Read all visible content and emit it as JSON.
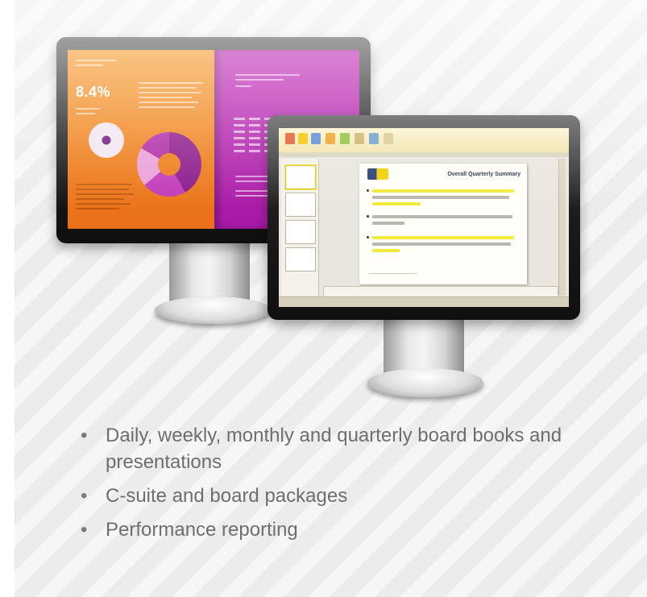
{
  "illustration": {
    "left_report": {
      "big_stat": "8.4%",
      "colors": {
        "left_page": "#ef7d1a",
        "right_page": "#b020aa"
      }
    },
    "right_viewer": {
      "document_title": "Overall Quarterly Summary",
      "colors": {
        "toolbar": "#f1e4a8",
        "highlight": "#f3ea3c"
      }
    }
  },
  "bullets": [
    {
      "text": "Daily, weekly, monthly and quarterly board books and presentations"
    },
    {
      "text": "C-suite and board packages"
    },
    {
      "text": "Performance reporting"
    }
  ],
  "bullet_glyph": "•"
}
